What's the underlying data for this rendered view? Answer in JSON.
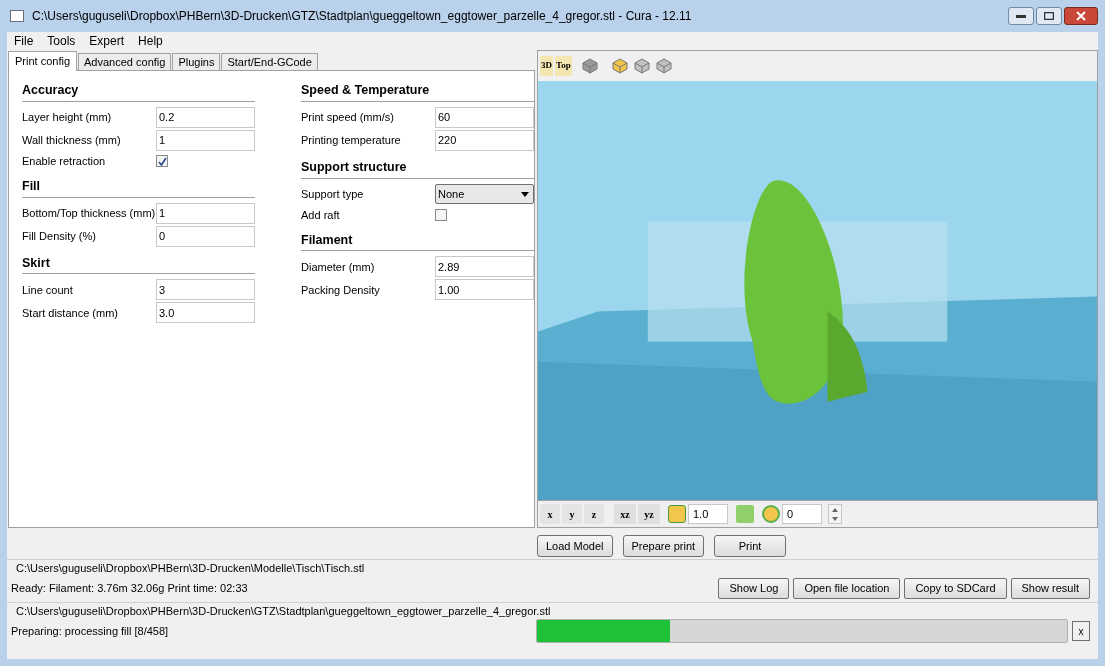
{
  "window": {
    "title": "C:\\Users\\guguseli\\Dropbox\\PHBern\\3D-Drucken\\GTZ\\Stadtplan\\gueggeltown_eggtower_parzelle_4_gregor.stl - Cura - 12.11"
  },
  "menu": [
    "File",
    "Tools",
    "Expert",
    "Help"
  ],
  "tabs": [
    {
      "label": "Print config",
      "selected": true
    },
    {
      "label": "Advanced config",
      "selected": false
    },
    {
      "label": "Plugins",
      "selected": false
    },
    {
      "label": "Start/End-GCode",
      "selected": false
    }
  ],
  "columns": [
    [
      {
        "title": "Accuracy",
        "fields": [
          {
            "kind": "text",
            "label": "Layer height (mm)",
            "value": "0.2"
          },
          {
            "kind": "text",
            "label": "Wall thickness (mm)",
            "value": "1"
          },
          {
            "kind": "check",
            "label": "Enable retraction",
            "checked": true
          }
        ]
      },
      {
        "title": "Fill",
        "fields": [
          {
            "kind": "text",
            "label": "Bottom/Top thickness (mm)",
            "value": "1"
          },
          {
            "kind": "text",
            "label": "Fill Density (%)",
            "value": "0"
          }
        ]
      },
      {
        "title": "Skirt",
        "fields": [
          {
            "kind": "text",
            "label": "Line count",
            "value": "3"
          },
          {
            "kind": "text",
            "label": "Start distance (mm)",
            "value": "3.0"
          }
        ]
      }
    ],
    [
      {
        "title": "Speed & Temperature",
        "fields": [
          {
            "kind": "text",
            "label": "Print speed (mm/s)",
            "value": "60"
          },
          {
            "kind": "text",
            "label": "Printing temperature",
            "value": "220"
          }
        ]
      },
      {
        "title": "Support structure",
        "fields": [
          {
            "kind": "select",
            "label": "Support type",
            "value": "None"
          },
          {
            "kind": "check",
            "label": "Add raft",
            "checked": false
          }
        ]
      },
      {
        "title": "Filament",
        "fields": [
          {
            "kind": "text",
            "label": "Diameter (mm)",
            "value": "2.89"
          },
          {
            "kind": "text",
            "label": "Packing Density",
            "value": "1.00"
          }
        ]
      }
    ]
  ],
  "view_toolbar": [
    {
      "label": "3D"
    },
    {
      "label": "Top"
    }
  ],
  "bottom_toolbar": {
    "axes": [
      "x",
      "y",
      "z"
    ],
    "mirrors": [
      "xz",
      "yz"
    ],
    "scale": "1.0",
    "rotate": "0"
  },
  "actions": [
    "Load Model",
    "Prepare print",
    "Print"
  ],
  "jobs": [
    {
      "file": "C:\\Users\\guguseli\\Dropbox\\PHBern\\3D-Drucken\\Modelle\\Tisch\\Tisch.stl",
      "status": "Ready: Filament: 3.76m 32.06g Print time: 02:33",
      "buttons": [
        "Show Log",
        "Open file location",
        "Copy to SDCard",
        "Show result"
      ]
    },
    {
      "file": "C:\\Users\\guguseli\\Dropbox\\PHBern\\3D-Drucken\\GTZ\\Stadtplan\\gueggeltown_eggtower_parzelle_4_gregor.stl",
      "status": "Preparing: processing fill [8/458]",
      "level": 0.25,
      "cancel": "x"
    }
  ]
}
